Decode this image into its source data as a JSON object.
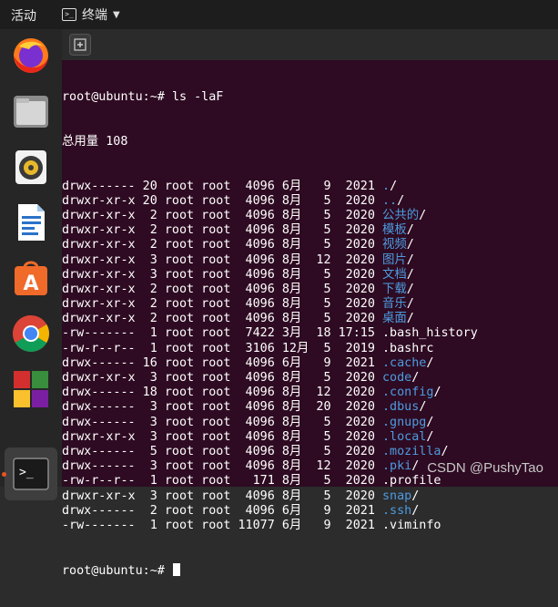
{
  "topbar": {
    "activities": "活动",
    "app_name": "终端",
    "app_icon": "terminal-icon"
  },
  "dock": [
    {
      "name": "firefox",
      "icon": "firefox-icon"
    },
    {
      "name": "files",
      "icon": "files-icon"
    },
    {
      "name": "rhythmbox",
      "icon": "rhythmbox-icon"
    },
    {
      "name": "writer",
      "icon": "libreoffice-writer-icon"
    },
    {
      "name": "software",
      "icon": "ubuntu-software-icon"
    },
    {
      "name": "chrome",
      "icon": "chrome-icon"
    },
    {
      "name": "game",
      "icon": "game-icon"
    },
    {
      "name": "terminal",
      "icon": "terminal-icon"
    }
  ],
  "terminal": {
    "prompt": "root@ubuntu:~#",
    "command": "ls -laF",
    "total_line": "总用量 108",
    "entries": [
      {
        "meta": "drwx------ 20 root root  4096 6月   9  2021 ",
        "name": ".",
        "suffix": "/",
        "is_dir": true
      },
      {
        "meta": "drwxr-xr-x 20 root root  4096 8月   5  2020 ",
        "name": "..",
        "suffix": "/",
        "is_dir": true
      },
      {
        "meta": "drwxr-xr-x  2 root root  4096 8月   5  2020 ",
        "name": "公共的",
        "suffix": "/",
        "is_dir": true
      },
      {
        "meta": "drwxr-xr-x  2 root root  4096 8月   5  2020 ",
        "name": "模板",
        "suffix": "/",
        "is_dir": true
      },
      {
        "meta": "drwxr-xr-x  2 root root  4096 8月   5  2020 ",
        "name": "视频",
        "suffix": "/",
        "is_dir": true
      },
      {
        "meta": "drwxr-xr-x  3 root root  4096 8月  12  2020 ",
        "name": "图片",
        "suffix": "/",
        "is_dir": true
      },
      {
        "meta": "drwxr-xr-x  3 root root  4096 8月   5  2020 ",
        "name": "文档",
        "suffix": "/",
        "is_dir": true
      },
      {
        "meta": "drwxr-xr-x  2 root root  4096 8月   5  2020 ",
        "name": "下载",
        "suffix": "/",
        "is_dir": true
      },
      {
        "meta": "drwxr-xr-x  2 root root  4096 8月   5  2020 ",
        "name": "音乐",
        "suffix": "/",
        "is_dir": true
      },
      {
        "meta": "drwxr-xr-x  2 root root  4096 8月   5  2020 ",
        "name": "桌面",
        "suffix": "/",
        "is_dir": true
      },
      {
        "meta": "-rw-------  1 root root  7422 3月  18 17:15 ",
        "name": ".bash_history",
        "suffix": "",
        "is_dir": false
      },
      {
        "meta": "-rw-r--r--  1 root root  3106 12月  5  2019 ",
        "name": ".bashrc",
        "suffix": "",
        "is_dir": false
      },
      {
        "meta": "drwx------ 16 root root  4096 6月   9  2021 ",
        "name": ".cache",
        "suffix": "/",
        "is_dir": true
      },
      {
        "meta": "drwxr-xr-x  3 root root  4096 8月   5  2020 ",
        "name": "code",
        "suffix": "/",
        "is_dir": true
      },
      {
        "meta": "drwx------ 18 root root  4096 8月  12  2020 ",
        "name": ".config",
        "suffix": "/",
        "is_dir": true
      },
      {
        "meta": "drwx------  3 root root  4096 8月  20  2020 ",
        "name": ".dbus",
        "suffix": "/",
        "is_dir": true
      },
      {
        "meta": "drwx------  3 root root  4096 8月   5  2020 ",
        "name": ".gnupg",
        "suffix": "/",
        "is_dir": true
      },
      {
        "meta": "drwxr-xr-x  3 root root  4096 8月   5  2020 ",
        "name": ".local",
        "suffix": "/",
        "is_dir": true
      },
      {
        "meta": "drwx------  5 root root  4096 8月   5  2020 ",
        "name": ".mozilla",
        "suffix": "/",
        "is_dir": true
      },
      {
        "meta": "drwx------  3 root root  4096 8月  12  2020 ",
        "name": ".pki",
        "suffix": "/",
        "is_dir": true
      },
      {
        "meta": "-rw-r--r--  1 root root   171 8月   5  2020 ",
        "name": ".profile",
        "suffix": "",
        "is_dir": false
      },
      {
        "meta": "drwxr-xr-x  3 root root  4096 8月   5  2020 ",
        "name": "snap",
        "suffix": "/",
        "is_dir": true
      },
      {
        "meta": "drwx------  2 root root  4096 6月   9  2021 ",
        "name": ".ssh",
        "suffix": "/",
        "is_dir": true
      },
      {
        "meta": "-rw-------  1 root root 11077 6月   9  2021 ",
        "name": ".viminfo",
        "suffix": "",
        "is_dir": false
      }
    ],
    "final_prompt": "root@ubuntu:~#",
    "colors": {
      "background": "#2e0b22",
      "text": "#ffffff",
      "directory": "#4d9be0"
    }
  },
  "watermark": "CSDN @PushyTao"
}
